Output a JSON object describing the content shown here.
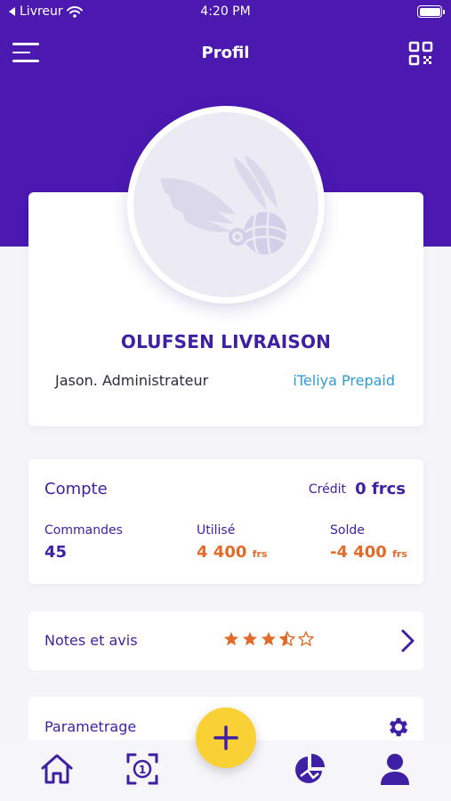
{
  "status_bar": {
    "carrier": "Livreur",
    "time": "4:20 PM"
  },
  "header": {
    "title": "Profil"
  },
  "profile": {
    "company_name": "OLUFSEN LIVRAISON",
    "user_role": "Jason. Administrateur",
    "account_type": "iTeliya Prepaid"
  },
  "account": {
    "title": "Compte",
    "credit_label": "Crédit",
    "credit_value": "0 frcs",
    "orders_label": "Commandes",
    "orders_value": "45",
    "used_label": "Utilisé",
    "used_value": "4 400",
    "used_unit": "frs",
    "balance_label": "Solde",
    "balance_value": "-4 400",
    "balance_unit": "frs"
  },
  "ratings": {
    "label": "Notes et avis",
    "rating": 3.5,
    "max": 5
  },
  "settings": {
    "label": "Parametrage"
  },
  "colors": {
    "primary": "#4b18b0",
    "accent": "#e36a29",
    "link": "#2f9ad9",
    "fab": "#f9d134"
  },
  "icons": {
    "menu": "menu-icon",
    "qr": "qr-code-icon",
    "home": "home-icon",
    "scan": "scan-icon",
    "add": "plus-icon",
    "stats": "pie-chart-icon",
    "profile": "user-icon",
    "settings": "gear-icon",
    "chevron": "chevron-right-icon"
  }
}
